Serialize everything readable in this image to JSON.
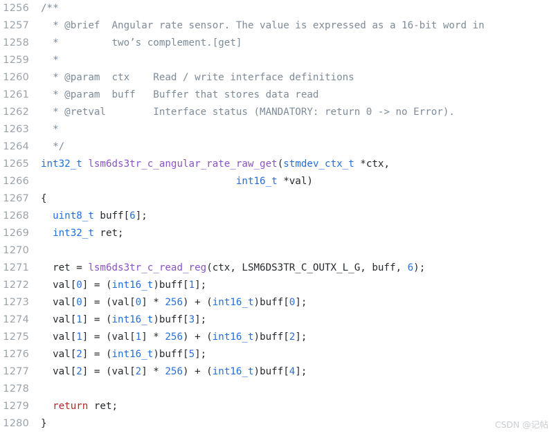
{
  "editor": {
    "language": "c",
    "first_line_number": 1256,
    "background_color": "#ffffff",
    "gutter_color": "#9aa3ab",
    "colors": {
      "comment": "#7d8b99",
      "type": "#1f6fe0",
      "function": "#8a52c9",
      "number": "#2b6fd6",
      "keyword": "#b02a2a",
      "plain": "#24292e"
    }
  },
  "watermark": {
    "text": "CSDN @记帖"
  },
  "lines": [
    {
      "number": "1256",
      "tokens": [
        {
          "t": "/**",
          "c": "comment"
        }
      ]
    },
    {
      "number": "1257",
      "tokens": [
        {
          "t": "  * @brief  Angular rate sensor. The value is expressed as a 16-bit word in",
          "c": "comment"
        }
      ]
    },
    {
      "number": "1258",
      "tokens": [
        {
          "t": "  *         two’s complement.[get]",
          "c": "comment"
        }
      ]
    },
    {
      "number": "1259",
      "tokens": [
        {
          "t": "  *",
          "c": "comment"
        }
      ]
    },
    {
      "number": "1260",
      "tokens": [
        {
          "t": "  * @param  ctx    Read / write interface definitions",
          "c": "comment"
        }
      ]
    },
    {
      "number": "1261",
      "tokens": [
        {
          "t": "  * @param  buff   Buffer that stores data read",
          "c": "comment"
        }
      ]
    },
    {
      "number": "1262",
      "tokens": [
        {
          "t": "  * @retval        Interface status (MANDATORY: return 0 -> no Error).",
          "c": "comment"
        }
      ]
    },
    {
      "number": "1263",
      "tokens": [
        {
          "t": "  *",
          "c": "comment"
        }
      ]
    },
    {
      "number": "1264",
      "tokens": [
        {
          "t": "  */",
          "c": "comment"
        }
      ]
    },
    {
      "number": "1265",
      "tokens": [
        {
          "t": "int32_t",
          "c": "type"
        },
        {
          "t": " ",
          "c": "plain"
        },
        {
          "t": "lsm6ds3tr_c_angular_rate_raw_get",
          "c": "func"
        },
        {
          "t": "(",
          "c": "plain"
        },
        {
          "t": "stmdev_ctx_t",
          "c": "type"
        },
        {
          "t": " *ctx,",
          "c": "plain"
        }
      ]
    },
    {
      "number": "1266",
      "tokens": [
        {
          "t": "                                 ",
          "c": "plain"
        },
        {
          "t": "int16_t",
          "c": "type"
        },
        {
          "t": " *val)",
          "c": "plain"
        }
      ]
    },
    {
      "number": "1267",
      "tokens": [
        {
          "t": "{",
          "c": "plain"
        }
      ]
    },
    {
      "number": "1268",
      "tokens": [
        {
          "t": "  ",
          "c": "plain"
        },
        {
          "t": "uint8_t",
          "c": "type"
        },
        {
          "t": " buff[",
          "c": "plain"
        },
        {
          "t": "6",
          "c": "number"
        },
        {
          "t": "];",
          "c": "plain"
        }
      ]
    },
    {
      "number": "1269",
      "tokens": [
        {
          "t": "  ",
          "c": "plain"
        },
        {
          "t": "int32_t",
          "c": "type"
        },
        {
          "t": " ret;",
          "c": "plain"
        }
      ]
    },
    {
      "number": "1270",
      "tokens": []
    },
    {
      "number": "1271",
      "tokens": [
        {
          "t": "  ret = ",
          "c": "plain"
        },
        {
          "t": "lsm6ds3tr_c_read_reg",
          "c": "func"
        },
        {
          "t": "(ctx, LSM6DS3TR_C_OUTX_L_G, buff, ",
          "c": "plain"
        },
        {
          "t": "6",
          "c": "number"
        },
        {
          "t": ");",
          "c": "plain"
        }
      ]
    },
    {
      "number": "1272",
      "tokens": [
        {
          "t": "  val[",
          "c": "plain"
        },
        {
          "t": "0",
          "c": "number"
        },
        {
          "t": "] = (",
          "c": "plain"
        },
        {
          "t": "int16_t",
          "c": "type"
        },
        {
          "t": ")buff[",
          "c": "plain"
        },
        {
          "t": "1",
          "c": "number"
        },
        {
          "t": "];",
          "c": "plain"
        }
      ]
    },
    {
      "number": "1273",
      "tokens": [
        {
          "t": "  val[",
          "c": "plain"
        },
        {
          "t": "0",
          "c": "number"
        },
        {
          "t": "] = (val[",
          "c": "plain"
        },
        {
          "t": "0",
          "c": "number"
        },
        {
          "t": "] * ",
          "c": "plain"
        },
        {
          "t": "256",
          "c": "number"
        },
        {
          "t": ") + (",
          "c": "plain"
        },
        {
          "t": "int16_t",
          "c": "type"
        },
        {
          "t": ")buff[",
          "c": "plain"
        },
        {
          "t": "0",
          "c": "number"
        },
        {
          "t": "];",
          "c": "plain"
        }
      ]
    },
    {
      "number": "1274",
      "tokens": [
        {
          "t": "  val[",
          "c": "plain"
        },
        {
          "t": "1",
          "c": "number"
        },
        {
          "t": "] = (",
          "c": "plain"
        },
        {
          "t": "int16_t",
          "c": "type"
        },
        {
          "t": ")buff[",
          "c": "plain"
        },
        {
          "t": "3",
          "c": "number"
        },
        {
          "t": "];",
          "c": "plain"
        }
      ]
    },
    {
      "number": "1275",
      "tokens": [
        {
          "t": "  val[",
          "c": "plain"
        },
        {
          "t": "1",
          "c": "number"
        },
        {
          "t": "] = (val[",
          "c": "plain"
        },
        {
          "t": "1",
          "c": "number"
        },
        {
          "t": "] * ",
          "c": "plain"
        },
        {
          "t": "256",
          "c": "number"
        },
        {
          "t": ") + (",
          "c": "plain"
        },
        {
          "t": "int16_t",
          "c": "type"
        },
        {
          "t": ")buff[",
          "c": "plain"
        },
        {
          "t": "2",
          "c": "number"
        },
        {
          "t": "];",
          "c": "plain"
        }
      ]
    },
    {
      "number": "1276",
      "tokens": [
        {
          "t": "  val[",
          "c": "plain"
        },
        {
          "t": "2",
          "c": "number"
        },
        {
          "t": "] = (",
          "c": "plain"
        },
        {
          "t": "int16_t",
          "c": "type"
        },
        {
          "t": ")buff[",
          "c": "plain"
        },
        {
          "t": "5",
          "c": "number"
        },
        {
          "t": "];",
          "c": "plain"
        }
      ]
    },
    {
      "number": "1277",
      "tokens": [
        {
          "t": "  val[",
          "c": "plain"
        },
        {
          "t": "2",
          "c": "number"
        },
        {
          "t": "] = (val[",
          "c": "plain"
        },
        {
          "t": "2",
          "c": "number"
        },
        {
          "t": "] * ",
          "c": "plain"
        },
        {
          "t": "256",
          "c": "number"
        },
        {
          "t": ") + (",
          "c": "plain"
        },
        {
          "t": "int16_t",
          "c": "type"
        },
        {
          "t": ")buff[",
          "c": "plain"
        },
        {
          "t": "4",
          "c": "number"
        },
        {
          "t": "];",
          "c": "plain"
        }
      ]
    },
    {
      "number": "1278",
      "tokens": []
    },
    {
      "number": "1279",
      "tokens": [
        {
          "t": "  ",
          "c": "plain"
        },
        {
          "t": "return",
          "c": "keyword"
        },
        {
          "t": " ret;",
          "c": "plain"
        }
      ]
    },
    {
      "number": "1280",
      "tokens": [
        {
          "t": "}",
          "c": "plain"
        }
      ]
    }
  ]
}
